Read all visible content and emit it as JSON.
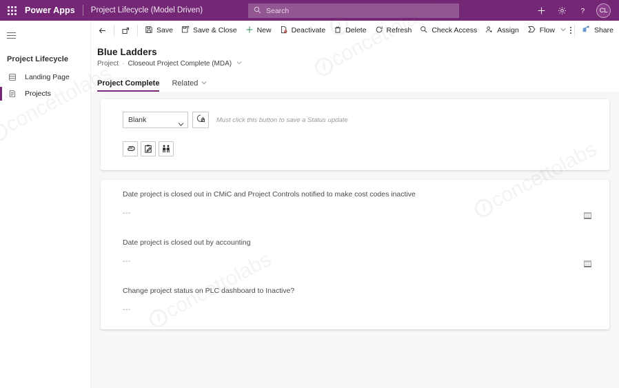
{
  "appbar": {
    "waffle_icon": "waffle-grid-icon",
    "brand": "Power Apps",
    "app_name": "Project Lifecycle (Model Driven)",
    "search": {
      "icon": "search-icon",
      "placeholder": "Search",
      "value": ""
    },
    "actions": [
      {
        "icon": "plus-icon",
        "label": "+"
      },
      {
        "icon": "gear-icon",
        "label": ""
      },
      {
        "icon": "question-mark-icon",
        "label": "?"
      }
    ],
    "avatar": {
      "initials": "CL",
      "name": "avatar"
    },
    "colors": {
      "bar": "#742774",
      "accent": "#742774"
    }
  },
  "sidebar": {
    "hamburger_icon": "hamburger-menu-icon",
    "header": "Project Lifecycle",
    "items": [
      {
        "label": "Landing Page",
        "icon": "dashboard-icon",
        "selected": false
      },
      {
        "label": "Projects",
        "icon": "project-list-icon",
        "selected": true
      }
    ]
  },
  "commandbar": {
    "back": {
      "icon": "back-arrow-icon",
      "label": ""
    },
    "popout": {
      "icon": "open-in-new-window-icon",
      "label": ""
    },
    "buttons": [
      {
        "icon": "save-icon",
        "label": "Save",
        "chevron": false
      },
      {
        "icon": "save-and-close-icon",
        "label": "Save & Close",
        "chevron": false
      },
      {
        "icon": "plus-icon",
        "label": "New",
        "chevron": false
      },
      {
        "icon": "deactivate-icon",
        "label": "Deactivate",
        "chevron": false
      },
      {
        "icon": "trash-icon",
        "label": "Delete",
        "chevron": false
      },
      {
        "icon": "refresh-icon",
        "label": "Refresh",
        "chevron": false
      },
      {
        "icon": "check-access-icon",
        "label": "Check Access",
        "chevron": false
      },
      {
        "icon": "assign-user-icon",
        "label": "Assign",
        "chevron": false
      },
      {
        "icon": "flow-icon",
        "label": "Flow",
        "chevron": true
      }
    ],
    "overflow": {
      "icon": "kebab-more-icon",
      "label": ""
    },
    "share": {
      "icon": "share-icon",
      "label": "Share",
      "chevron": true
    }
  },
  "form_header": {
    "record_title": "Blue Ladders",
    "breadcrumb": {
      "entity": "Project",
      "separator": "·",
      "current": "Closeout Project Complete (MDA)",
      "chevron_icon": "chevron-down-icon"
    },
    "tabs": [
      {
        "label": "Project Complete",
        "active": true,
        "chevron": false
      },
      {
        "label": "Related",
        "active": false,
        "chevron": true
      }
    ]
  },
  "status_card": {
    "status_select": {
      "value": "Blank",
      "options": [
        "Blank"
      ],
      "chevron_icon": "chevron-down-icon"
    },
    "save_status_button": {
      "icon": "save-status-icon",
      "label": ""
    },
    "hint": "Must click this button to save a Status update",
    "icon_buttons": [
      {
        "icon": "paperclip-attach-icon",
        "label": ""
      },
      {
        "icon": "clipboard-edit-icon",
        "label": ""
      },
      {
        "icon": "people-team-icon",
        "label": ""
      }
    ]
  },
  "detail_card": {
    "fields": [
      {
        "label": "Date project is closed out in CMiC and Project Controls notified to make cost codes inactive",
        "value": "---",
        "calendar_icon": "calendar-icon",
        "has_calendar": true
      },
      {
        "label": "Date project is closed out by accounting",
        "value": "---",
        "calendar_icon": "calendar-icon",
        "has_calendar": true
      },
      {
        "label": "Change project status on PLC dashboard to Inactive?",
        "value": "---",
        "calendar_icon": "",
        "has_calendar": false
      }
    ]
  },
  "watermark": {
    "text": "concettolabs"
  }
}
